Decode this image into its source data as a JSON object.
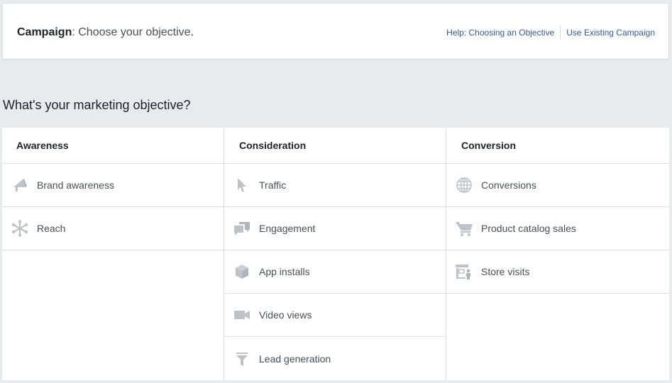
{
  "header": {
    "title_bold": "Campaign",
    "title_rest": ": Choose your objective",
    "title_dot": ".",
    "help_link": "Help: Choosing an Objective",
    "existing_link": "Use Existing Campaign"
  },
  "heading": "What's your marketing objective?",
  "columns": [
    {
      "title": "Awareness",
      "items": [
        {
          "label": "Brand awareness",
          "icon": "megaphone-icon"
        },
        {
          "label": "Reach",
          "icon": "reach-asterisk-icon"
        }
      ]
    },
    {
      "title": "Consideration",
      "items": [
        {
          "label": "Traffic",
          "icon": "cursor-icon"
        },
        {
          "label": "Engagement",
          "icon": "chat-bubbles-icon"
        },
        {
          "label": "App installs",
          "icon": "box-icon"
        },
        {
          "label": "Video views",
          "icon": "video-camera-icon"
        },
        {
          "label": "Lead generation",
          "icon": "funnel-icon"
        }
      ]
    },
    {
      "title": "Conversion",
      "items": [
        {
          "label": "Conversions",
          "icon": "globe-icon"
        },
        {
          "label": "Product catalog sales",
          "icon": "shopping-cart-icon"
        },
        {
          "label": "Store visits",
          "icon": "store-person-icon"
        }
      ]
    }
  ],
  "colors": {
    "icon": "#bec3c9",
    "link": "#365899",
    "text": "#4b4f56",
    "border": "#dddfe2",
    "background": "#e9eaed"
  }
}
